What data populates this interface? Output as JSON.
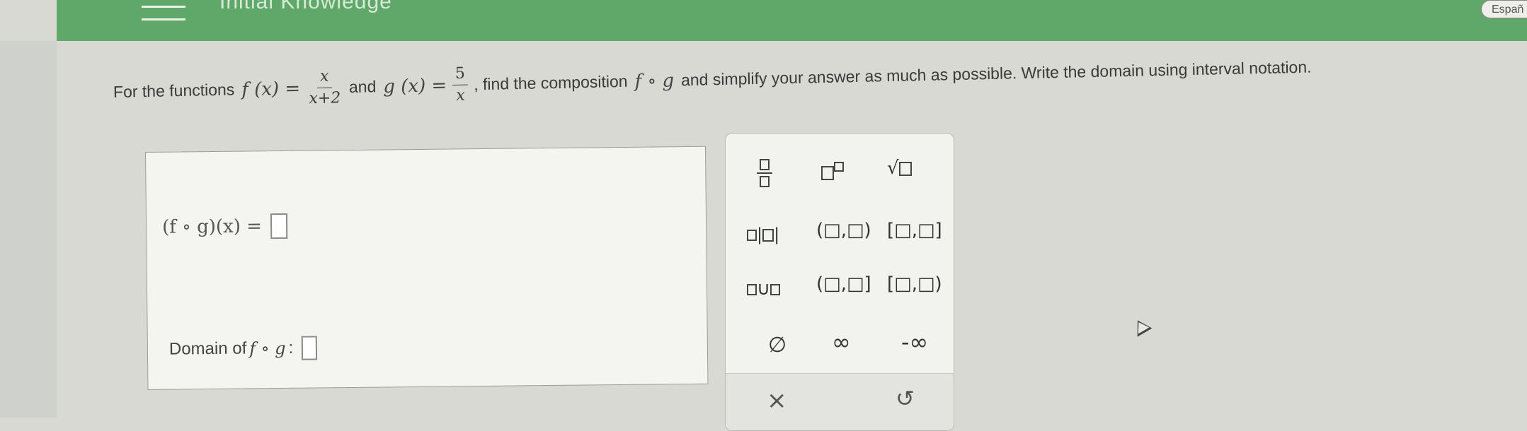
{
  "header": {
    "topic": "Initial Knowledge",
    "language_button": "Españ"
  },
  "question": {
    "prefix": "For the functions",
    "f_lhs": "f (x) =",
    "f_num": "x",
    "f_den": "x+2",
    "and": "and",
    "g_lhs": "g (x) =",
    "g_num": "5",
    "g_den": "x",
    "suffix": ", find the composition",
    "composition": "f ∘ g",
    "tail": "and simplify your answer as much as possible. Write the domain using interval notation."
  },
  "answer": {
    "fog_label": "(f ∘ g)(x) =",
    "domain_label": "Domain of",
    "domain_func": "f ∘ g",
    "domain_colon": ":"
  },
  "palette": {
    "row3": [
      "∪",
      "(□,□]",
      "[□,□)"
    ],
    "row2": [
      "(□,□)",
      "[□,□]"
    ],
    "empty_set": "∅",
    "infinity": "∞",
    "neg_infinity": "-∞",
    "clear": "×",
    "undo": "↺"
  }
}
